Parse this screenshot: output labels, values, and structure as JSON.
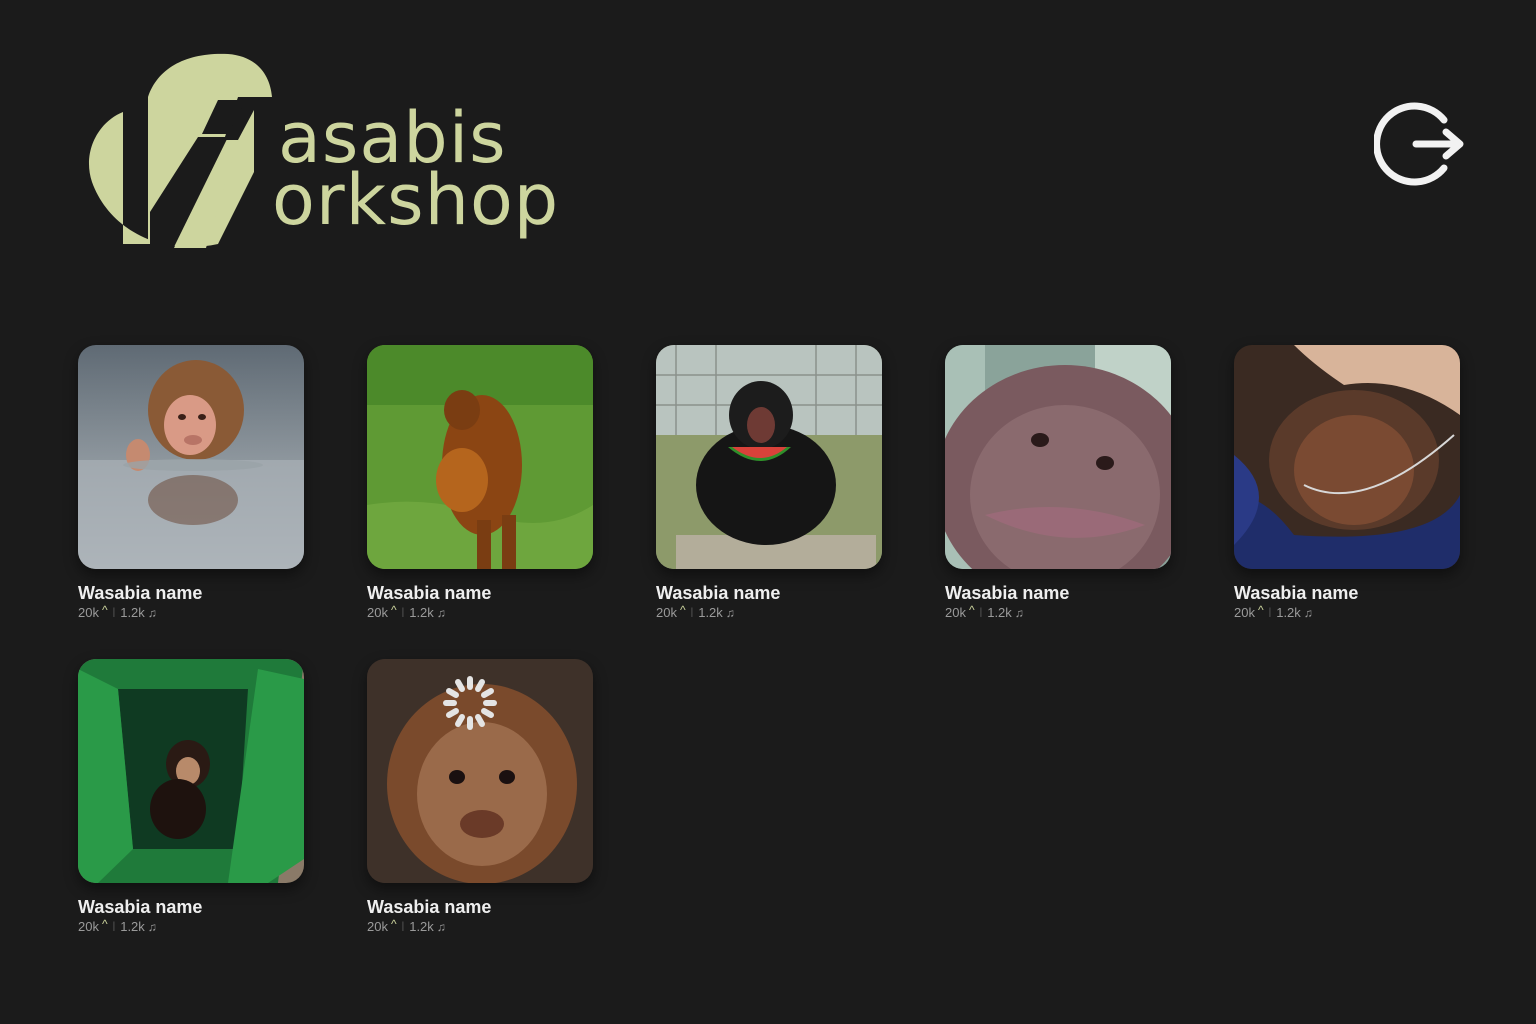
{
  "header": {
    "logo_line1": "asabis",
    "logo_line2": "orkshop",
    "brand_color": "#cdd59e",
    "logout_icon": "logout-icon"
  },
  "cards": [
    {
      "name": "Wasabia name",
      "likes": "20k",
      "plays": "1.2k",
      "thumb": "macaque-in-water"
    },
    {
      "name": "Wasabia name",
      "likes": "20k",
      "plays": "1.2k",
      "thumb": "orangutan-on-grass"
    },
    {
      "name": "Wasabia name",
      "likes": "20k",
      "plays": "1.2k",
      "thumb": "chimp-with-watermelon"
    },
    {
      "name": "Wasabia name",
      "likes": "20k",
      "plays": "1.2k",
      "thumb": "orangutan-closeup"
    },
    {
      "name": "Wasabia name",
      "likes": "20k",
      "plays": "1.2k",
      "thumb": "baby-orangutan-blanket"
    },
    {
      "name": "Wasabia name",
      "likes": "20k",
      "plays": "1.2k",
      "thumb": "baby-chimp-in-crate"
    },
    {
      "name": "Wasabia name",
      "likes": "20k",
      "plays": "1.2k",
      "thumb": "orangutan-loading"
    }
  ]
}
